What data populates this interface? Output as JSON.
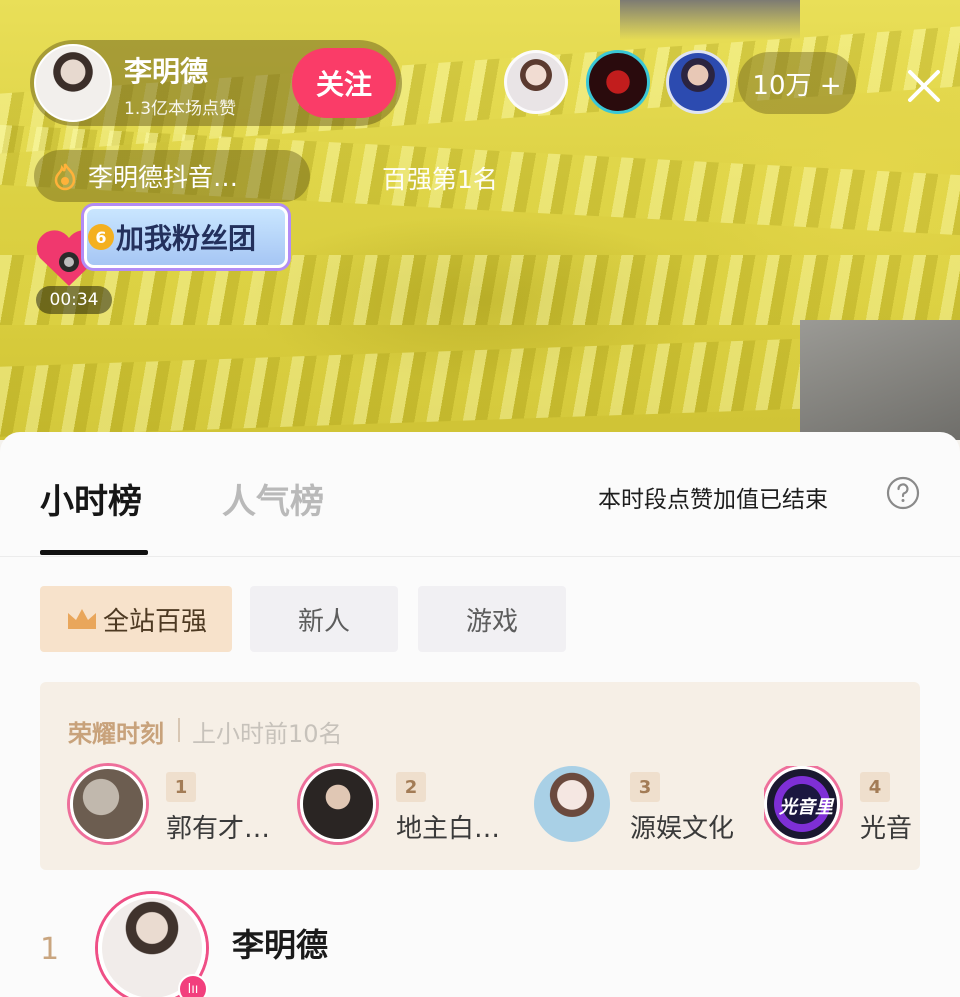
{
  "streamer": {
    "name": "李明德",
    "likes": "1.3亿本场点赞",
    "follow_label": "关注"
  },
  "viewers": {
    "count": "10万 +"
  },
  "overlay": {
    "douyin_label": "李明德抖音…",
    "rank_label": "百强第1名",
    "fan_club_label": "加我粉丝团",
    "fan_level": "6",
    "timer": "00:34"
  },
  "sheet": {
    "tabs": [
      {
        "label": "小时榜",
        "active": true
      },
      {
        "label": "人气榜",
        "active": false
      }
    ],
    "status_text": "本时段点赞加值已结束",
    "chips": [
      "全站百强",
      "新人",
      "游戏"
    ],
    "honor": {
      "title": "荣耀时刻",
      "subtitle": "上小时前10名",
      "items": [
        {
          "rank": "1",
          "name": "郭有才…"
        },
        {
          "rank": "2",
          "name": "地主白…"
        },
        {
          "rank": "3",
          "name": "源娱文化"
        },
        {
          "rank": "4",
          "name": "光音"
        }
      ],
      "item4_avatar_text": "光音里"
    },
    "current": {
      "rank": "1",
      "name": "李明德",
      "badge": "lıı"
    }
  },
  "colors": {
    "accent_pink": "#fa3c68",
    "honor_gold": "#c8a27b",
    "chip_active_bg": "#f7e2cb"
  },
  "icons": [
    "close-icon",
    "flame-icon",
    "help-icon",
    "crown-icon",
    "live-icon"
  ]
}
